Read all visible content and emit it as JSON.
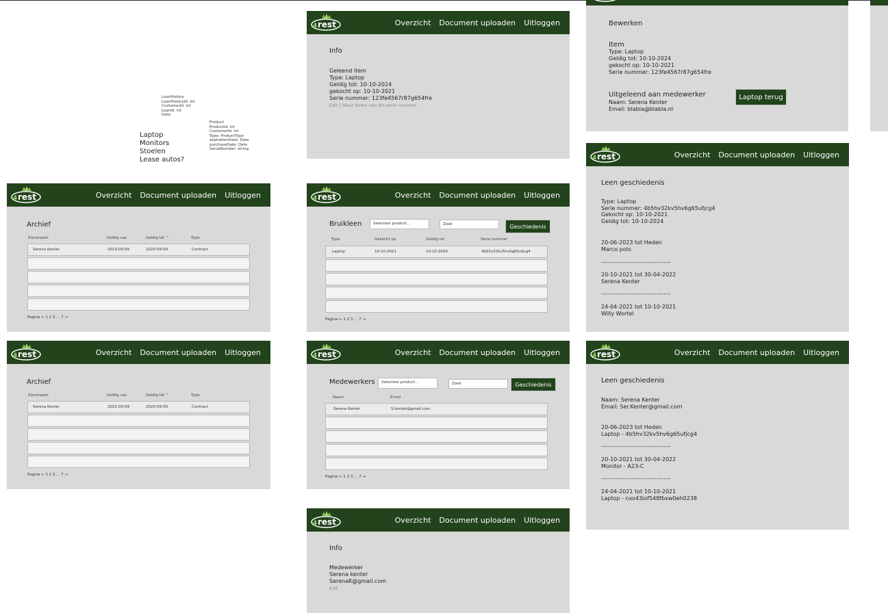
{
  "nav": {
    "overview": "Overzicht",
    "upload": "Document uploaden",
    "logout": "Uitloggen"
  },
  "colors": {
    "nav_bg": "#22431b",
    "frame_bg": "#d9d9d9",
    "button_bg": "#22431b"
  },
  "notes": {
    "categories": [
      "Laptop",
      "Monitors",
      "Stoelen",
      "Lease autos?"
    ],
    "loan_history_model": [
      "LoanHistory",
      "LoanHistoryId: int",
      "CustomerId: int",
      "LoanId: int",
      "Date"
    ],
    "product_model": [
      "Product",
      "ProductId: int",
      "CustomerId: int",
      "Type: ProductType",
      "expirationDate: Date",
      "purchaseDate: Date",
      "SerialNumber: string"
    ]
  },
  "info_item": {
    "title": "Info",
    "lines": [
      "Geleend item",
      "Type: Laptop",
      "Geldig tot: 10-10-2024",
      "gekocht op: 10-10-2021",
      "Serie nummer: 123fe4567r87g654fre"
    ],
    "links": "Edit | Meer items van dit serie nummer"
  },
  "edit": {
    "title": "Bewerken",
    "item_lines": [
      "Item",
      "Type: Laptop",
      "Geldig tot: 10-10-2024",
      "gekocht op: 10-10-2021",
      "Serie nummer: 123fe4567r87g654fre"
    ],
    "loaned_lines": [
      "Uitgeleend aan medewerker",
      "Naam: Serena Kenter",
      "Email: blabla@blabla.nl"
    ],
    "return_button": "Laptop terug"
  },
  "archive": {
    "title": "Archief",
    "columns": [
      "Klantnaam",
      "Geldig van",
      "Geldig tot ^",
      "Type"
    ],
    "row": [
      "Serena Kenter",
      "2023-09-09",
      "2023-09-09",
      "Contract"
    ],
    "pagination": "Pagina ← 1 2 3 ... 7 →"
  },
  "loan": {
    "title": "Bruikleen",
    "select_placeholder": "Selecteer product...",
    "search_placeholder": "Zoek",
    "history_button": "Geschiedenis",
    "columns": [
      "Type",
      "Gekocht op",
      "Geldig tot",
      "Serie nummer"
    ],
    "row": [
      "Laptop",
      "10-10-2021",
      "10-10-2024",
      "4b5hv32kv5hv6g65ufjcg4"
    ],
    "pagination": "Pagina ← 1 2 3 ... 7 →"
  },
  "employees": {
    "title": "Medewerkers",
    "select_placeholder": "Selecteer product...",
    "search_placeholder": "Zoek",
    "history_button": "Geschiedenis",
    "columns": [
      "Naam",
      "Email"
    ],
    "row": [
      "Serena Kenter",
      "S.kenter@gmail.com"
    ],
    "pagination": "Pagina ← 1 2 3 ... 7 →"
  },
  "info_employee": {
    "title": "Info",
    "lines": [
      "Medewerker",
      "Serena kenter",
      "SerenaK@gmail.com"
    ],
    "link": "Edit"
  },
  "history_product": {
    "title": "Leen geschiedenis",
    "info": [
      "Type: Laptop",
      "Serie nummer: 4b5hv32kv5hv6g65ufjcg4",
      "Gekocht op: 10-10-2021",
      "Geldig tot: 10-10-2024"
    ],
    "entries": [
      {
        "period": "20-06-2023 tot Heden",
        "who": "Marco polo"
      },
      {
        "period": "20-10-2021 tot 30-04-2022",
        "who": "Serena Kenter"
      },
      {
        "period": "24-04-2021 tot 10-10-2021",
        "who": "Willy Wortel"
      }
    ],
    "separator": "------------------------------"
  },
  "history_employee": {
    "title": "Leen geschiedenis",
    "info": [
      "Naam: Serena Kenter",
      "Email: Ser.Kenter@gmail.com"
    ],
    "entries": [
      {
        "period": "20-06-2023 tot Heden",
        "what": "Laptop - 4b5hv32kv5hv6g65ufjcg4"
      },
      {
        "period": "20-10-2021 tot 30-04-2022",
        "what": "Monitor - A23-C"
      },
      {
        "period": "24-04-2021 tot 10-10-2021",
        "what": "Laptop - nxo43iof548fbxw0eh0238"
      }
    ],
    "separator": "------------------------------"
  }
}
